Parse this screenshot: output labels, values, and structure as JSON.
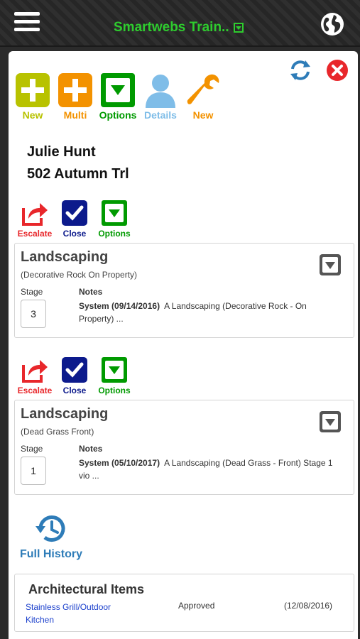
{
  "header": {
    "title": "Smartwebs Train..",
    "menu_icon": "hamburger-menu-icon",
    "globe_icon": "globe-icon"
  },
  "toolbar": {
    "refresh_icon": "refresh-icon",
    "close_icon": "close-icon",
    "tools": [
      {
        "label": "New",
        "icon": "plus-icon",
        "color": "#b8c200"
      },
      {
        "label": "Multi",
        "icon": "plus-icon",
        "color": "#f39200"
      },
      {
        "label": "Options",
        "icon": "dropdown-box-icon",
        "color": "#009a00"
      },
      {
        "label": "Details",
        "icon": "user-icon",
        "color": "#7fbde8"
      },
      {
        "label": "New",
        "icon": "wrench-icon",
        "color": "#f39200"
      }
    ]
  },
  "customer": {
    "name": "Julie Hunt",
    "address": "502 Autumn Trl"
  },
  "actions": {
    "escalate": "Escalate",
    "close": "Close",
    "options": "Options"
  },
  "items": [
    {
      "title": "Landscaping",
      "subtitle": "(Decorative Rock On Property)",
      "stage_label": "Stage",
      "stage": "3",
      "notes_label": "Notes",
      "notes_author": "System (09/14/2016)",
      "notes_text": "A Landscaping (Decorative Rock - On Property) ..."
    },
    {
      "title": "Landscaping",
      "subtitle": "(Dead Grass Front)",
      "stage_label": "Stage",
      "stage": "1",
      "notes_label": "Notes",
      "notes_author": "System (05/10/2017)",
      "notes_text": "A Landscaping (Dead Grass - Front) Stage 1 vio ..."
    }
  ],
  "history": {
    "label": "Full History",
    "icon": "history-icon"
  },
  "architectural": {
    "title": "Architectural Items",
    "item": "Stainless Grill/Outdoor Kitchen",
    "status": "Approved",
    "date": "(12/08/2016)"
  },
  "colors": {
    "accent_green": "#2ecc2e",
    "escalate_red": "#e8272b",
    "close_navy": "#0c1a8c",
    "options_green": "#009a00",
    "link_blue": "#2e7cb8"
  }
}
